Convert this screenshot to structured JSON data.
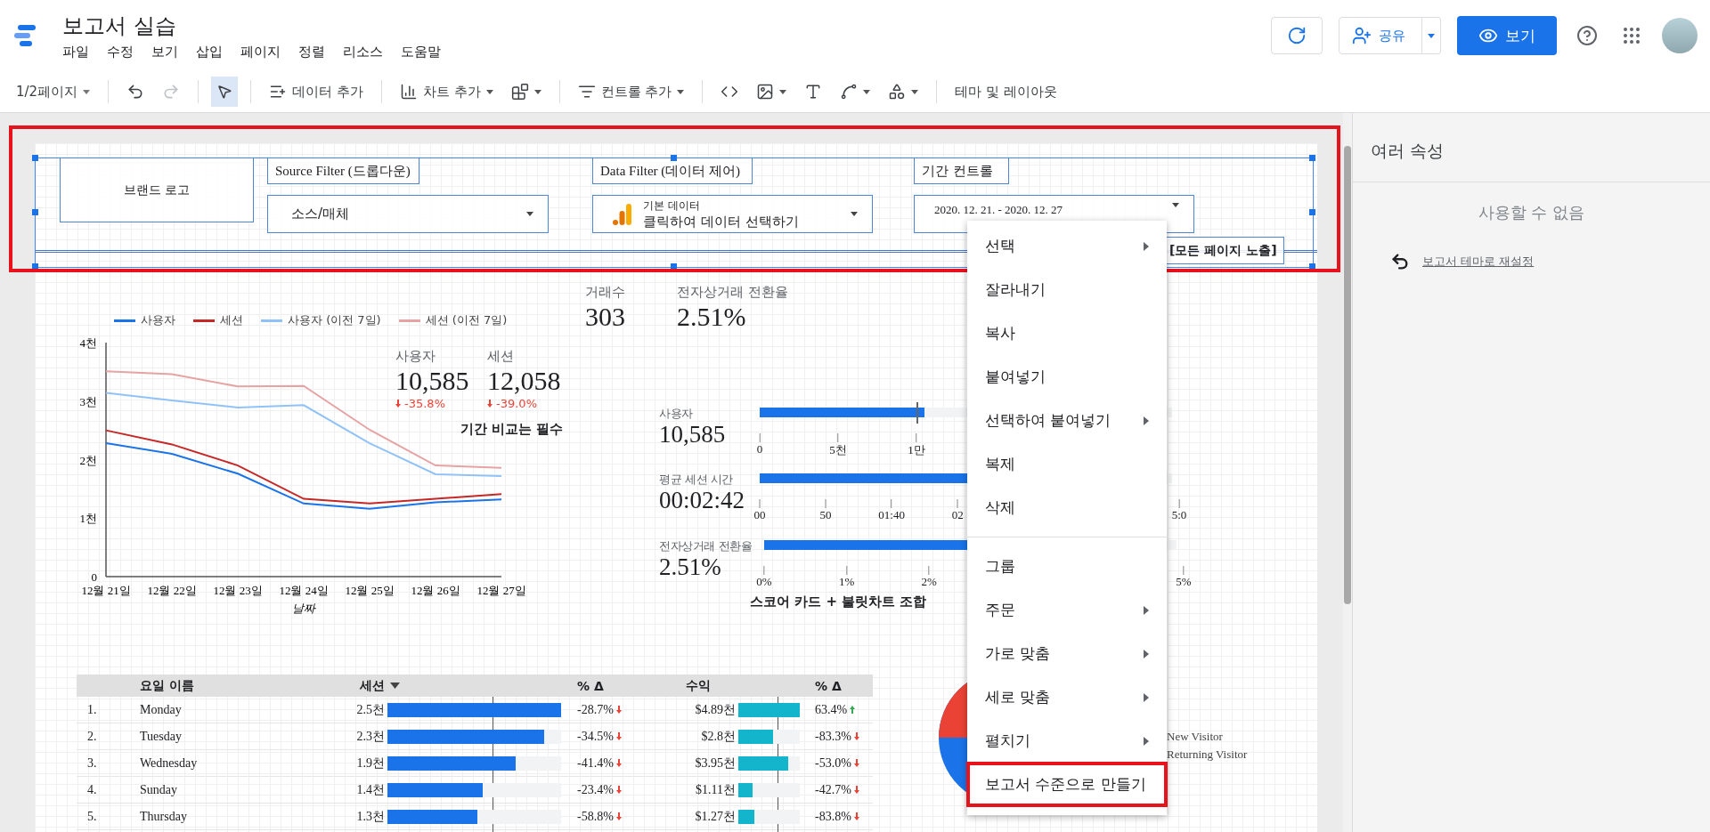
{
  "app": {
    "title": "보고서 실습",
    "menu": [
      "파일",
      "수정",
      "보기",
      "삽입",
      "페이지",
      "정렬",
      "리소스",
      "도움말"
    ],
    "share_label": "공유",
    "view_label": "보기"
  },
  "toolbar": {
    "page": "1/2페이지",
    "undo": {
      "disabled": false
    },
    "redo": {
      "disabled": true
    },
    "pointer": {
      "selected": true
    },
    "groups": [
      [
        {
          "kind": "add-data",
          "label": "데이터 추가",
          "dropdown": false
        }
      ],
      [
        {
          "kind": "add-chart",
          "label": "차트 추가",
          "dropdown": true
        },
        {
          "kind": "community",
          "dropdown": true
        }
      ],
      [
        {
          "kind": "add-control",
          "label": "컨트롤 추가",
          "dropdown": true
        }
      ],
      [
        {
          "kind": "code",
          "dropdown": false
        },
        {
          "kind": "image",
          "dropdown": true
        },
        {
          "kind": "textbox",
          "dropdown": false
        },
        {
          "kind": "line",
          "dropdown": true
        },
        {
          "kind": "shape",
          "dropdown": true
        }
      ],
      [
        {
          "kind": "text",
          "label": "테마 및 레이아웃",
          "dropdown": false
        }
      ]
    ]
  },
  "report": {
    "header": {
      "selected": true,
      "highlighted": true,
      "logo_text": "브랜드 로고",
      "source_filter": {
        "title": "Source Filter (드롭다운)",
        "value": "소스/매체"
      },
      "data_filter": {
        "title": "Data Filter (데이터 제어)",
        "subtitle": "기본 데이터",
        "value": "클릭하여 데이터 선택하기"
      },
      "date_control": {
        "title": "기간 컨트롤",
        "value": "2020. 12. 21. - 2020. 12. 27"
      },
      "note": "[모든 페이지 노출]"
    },
    "scorecards": [
      {
        "label": "거래수",
        "value": "303"
      },
      {
        "label": "전자상거래 전환율",
        "value": "2.51%"
      }
    ],
    "time_series": {
      "chart_data": {
        "type": "line",
        "xlabel": "날짜",
        "categories": [
          "12월 21일",
          "12월 22일",
          "12월 23일",
          "12월 24일",
          "12월 25일",
          "12월 26일",
          "12월 27일"
        ],
        "ylim": [
          0,
          4
        ],
        "yticks": [
          {
            "value": 0,
            "label": "0"
          },
          {
            "value": 1,
            "label": "1천"
          },
          {
            "value": 2,
            "label": "2천"
          },
          {
            "value": 3,
            "label": "3천"
          },
          {
            "value": 4,
            "label": "4천"
          }
        ],
        "series": [
          {
            "name": "사용자",
            "color": "#1a73e8",
            "values": [
              2.28,
              2.1,
              1.76,
              1.25,
              1.16,
              1.27,
              1.32
            ]
          },
          {
            "name": "세션",
            "color": "#c62828",
            "values": [
              2.5,
              2.26,
              1.9,
              1.33,
              1.25,
              1.33,
              1.41
            ]
          },
          {
            "name": "사용자 (이전 7일)",
            "color": "#90c2f8",
            "values": [
              3.14,
              3.01,
              2.89,
              2.93,
              2.28,
              1.75,
              1.72
            ]
          },
          {
            "name": "세션 (이전 7일)",
            "color": "#e6a3a3",
            "values": [
              3.51,
              3.46,
              3.25,
              3.26,
              2.51,
              1.9,
              1.86
            ]
          }
        ]
      }
    },
    "comparison_scorecards": [
      {
        "label": "사용자",
        "value": "10,585",
        "change": "-35.8%",
        "increase": false
      },
      {
        "label": "세션",
        "value": "12,058",
        "change": "-39.0%",
        "increase": false
      }
    ],
    "comparison_note": "기간 비교는 필수",
    "bullets": [
      {
        "label": "사용자",
        "value": "10,585",
        "level": 0.4,
        "has_target": true,
        "ticks": [
          "0",
          "5천",
          "1만"
        ]
      },
      {
        "label": "평균 세션 시간",
        "value": "00:02:42",
        "level": 0.62,
        "has_target": false,
        "ticks": [
          "00",
          "50",
          "01:40",
          "02"
        ],
        "end_tick": "5:0"
      },
      {
        "label": "전자상거래 전환율",
        "value": "2.51%",
        "level": 0.6,
        "has_target": false,
        "ticks": [
          "0%",
          "1%",
          "2%"
        ],
        "end_tick": "5%"
      }
    ],
    "bullet_caption": "스코어 카드 + 불릿차트 조합",
    "table": {
      "columns": [
        {
          "label": "요일 이름",
          "sorted": false
        },
        {
          "label": "세션",
          "sorted": true
        },
        {
          "label": "% Δ",
          "sorted": false
        },
        {
          "label": "수익",
          "sorted": false
        },
        {
          "label": "% Δ",
          "sorted": false
        }
      ],
      "rows": [
        {
          "index": "1.",
          "day": "Monday",
          "sessions": {
            "value": "2.5천",
            "level": 1
          },
          "sessions_change": {
            "value": "-28.7%",
            "increase": false
          },
          "revenue": {
            "value": "$4.89천",
            "level": 1
          },
          "revenue_change": {
            "value": "63.4%",
            "increase": true
          }
        },
        {
          "index": "2.",
          "day": "Tuesday",
          "sessions": {
            "value": "2.3천",
            "level": 0.9
          },
          "sessions_change": {
            "value": "-34.5%",
            "increase": false
          },
          "revenue": {
            "value": "$2.8천",
            "level": 0.57
          },
          "revenue_change": {
            "value": "-83.3%",
            "increase": false
          }
        },
        {
          "index": "3.",
          "day": "Wednesday",
          "sessions": {
            "value": "1.9천",
            "level": 0.74
          },
          "sessions_change": {
            "value": "-41.4%",
            "increase": false
          },
          "revenue": {
            "value": "$3.95천",
            "level": 0.81
          },
          "revenue_change": {
            "value": "-53.0%",
            "increase": false
          }
        },
        {
          "index": "4.",
          "day": "Sunday",
          "sessions": {
            "value": "1.4천",
            "level": 0.55
          },
          "sessions_change": {
            "value": "-23.4%",
            "increase": false
          },
          "revenue": {
            "value": "$1.11천",
            "level": 0.23
          },
          "revenue_change": {
            "value": "-42.7%",
            "increase": false
          }
        },
        {
          "index": "5.",
          "day": "Thursday",
          "sessions": {
            "value": "1.3천",
            "level": 0.52
          },
          "sessions_change": {
            "value": "-58.8%",
            "increase": false
          },
          "revenue": {
            "value": "$1.27천",
            "level": 0.26
          },
          "revenue_change": {
            "value": "-83.8%",
            "increase": false
          }
        }
      ]
    },
    "pie": {
      "legend": [
        "New Visitor",
        "Returning Visitor"
      ]
    }
  },
  "context_menu": {
    "items": [
      {
        "label": "선택",
        "submenu": true,
        "divider_before": false,
        "highlighted": false
      },
      {
        "label": "잘라내기",
        "submenu": false,
        "divider_before": false,
        "highlighted": false
      },
      {
        "label": "복사",
        "submenu": false,
        "divider_before": false,
        "highlighted": false
      },
      {
        "label": "붙여넣기",
        "submenu": false,
        "divider_before": false,
        "highlighted": false
      },
      {
        "label": "선택하여 붙여넣기",
        "submenu": true,
        "divider_before": false,
        "highlighted": false
      },
      {
        "label": "복제",
        "submenu": false,
        "divider_before": false,
        "highlighted": false
      },
      {
        "label": "삭제",
        "submenu": false,
        "divider_before": false,
        "highlighted": false
      },
      {
        "label": "그룹",
        "submenu": false,
        "divider_before": true,
        "highlighted": false
      },
      {
        "label": "주문",
        "submenu": true,
        "divider_before": false,
        "highlighted": false
      },
      {
        "label": "가로 맞춤",
        "submenu": true,
        "divider_before": false,
        "highlighted": false
      },
      {
        "label": "세로 맞춤",
        "submenu": true,
        "divider_before": false,
        "highlighted": false
      },
      {
        "label": "펼치기",
        "submenu": true,
        "divider_before": false,
        "highlighted": false
      },
      {
        "label": "보고서 수준으로 만들기",
        "submenu": false,
        "divider_before": false,
        "highlighted": true
      }
    ]
  },
  "side_panel": {
    "title": "여러 속성",
    "message": "사용할 수 없음",
    "reset_link": "보고서 테마로 재설정"
  }
}
